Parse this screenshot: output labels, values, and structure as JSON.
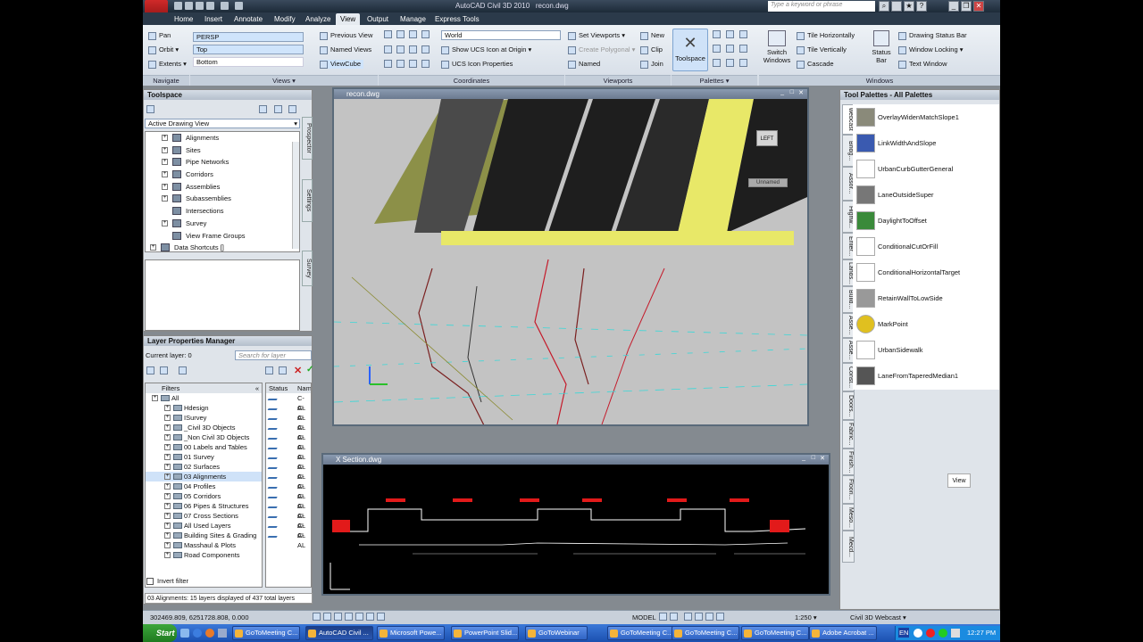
{
  "title": {
    "app": "AutoCAD Civil 3D 2010",
    "file": "recon.dwg"
  },
  "search": {
    "placeholder": "Type a keyword or phrase"
  },
  "tabs": [
    "Home",
    "Insert",
    "Annotate",
    "Modify",
    "Analyze",
    "View",
    "Output",
    "Manage",
    "Express Tools"
  ],
  "active_tab": "View",
  "ribbon": {
    "navigate": {
      "pan": "Pan",
      "orbit": "Orbit",
      "extents": "Extents",
      "title": "Navigate"
    },
    "views": {
      "persp": "PERSP",
      "top": "Top",
      "bottom": "Bottom",
      "previous": "Previous View",
      "named": "Named Views",
      "viewcube": "ViewCube",
      "title": "Views"
    },
    "coordinates": {
      "world": "World",
      "show_ucs": "Show UCS Icon at Origin",
      "ucs_props": "UCS Icon Properties",
      "title": "Coordinates"
    },
    "viewports": {
      "set": "Set Viewports",
      "create_poly": "Create Polygonal",
      "named": "Named",
      "new": "New",
      "clip": "Clip",
      "join": "Join",
      "title": "Viewports"
    },
    "palettes": {
      "toolspace": "Toolspace",
      "title": "Palettes"
    },
    "windows": {
      "switch": "Switch Windows",
      "tile_h": "Tile Horizontally",
      "tile_v": "Tile Vertically",
      "cascade": "Cascade",
      "status_bar": "Status Bar",
      "drawing_status": "Drawing Status Bar",
      "window_locking": "Window Locking",
      "text_window": "Text Window",
      "title": "Windows"
    }
  },
  "toolspace": {
    "title": "Toolspace",
    "view_selector": "Active Drawing View",
    "items": [
      "Alignments",
      "Sites",
      "Pipe Networks",
      "Corridors",
      "Assemblies",
      "Subassemblies",
      "Intersections",
      "Survey",
      "View Frame Groups",
      "Data Shortcuts []"
    ],
    "vtabs": [
      "Prospector",
      "Settings",
      "Survey"
    ]
  },
  "layers": {
    "title": "Layer Properties Manager",
    "current": "Current layer: 0",
    "search_placeholder": "Search for layer",
    "filters_header": "Filters",
    "status_header": "Status",
    "name_header": "Nam",
    "filters": [
      "All",
      "Hdesign",
      "ISurvey",
      "_Civil 3D Objects",
      "_Non Civil 3D Objects",
      "00 Labels and Tables",
      "01 Survey",
      "02 Surfaces",
      "03 Alignments",
      "04 Profiles",
      "05 Corridors",
      "06 Pipes & Structures",
      "07 Cross Sections",
      "All Used Layers",
      "Building Sites & Grading",
      "Masshaul & Plots",
      "Road Components"
    ],
    "name_cells": [
      "C-AL",
      "C-AL",
      "C-AL",
      "C-AL",
      "C-AL",
      "C-AL",
      "C-AL",
      "C-AL",
      "C-AL",
      "C-AL",
      "C-AL",
      "C-AL",
      "C-AL",
      "C-AL",
      "C-AL"
    ],
    "invert": "Invert filter",
    "footer": "03 Alignments: 15 layers displayed of 437 total layers"
  },
  "drawing1": {
    "title": "recon.dwg",
    "viewcube_face": "LEFT",
    "viewcube_label": "Unnamed"
  },
  "drawing2": {
    "title": "X Section.dwg"
  },
  "palettes": {
    "title": "Tool Palettes - All Palettes",
    "items": [
      "OverlayWidenMatchSlope1",
      "LinkWidthAndSlope",
      "UrbanCurbGutterGeneral",
      "LaneOutsideSuper",
      "DaylightToOffset",
      "ConditionalCutOrFill",
      "ConditionalHorizontalTarget",
      "RetainWallToLowSide",
      "MarkPoint",
      "UrbanSidewalk",
      "LaneFromTaperedMedian1"
    ],
    "tabs": [
      "webcast",
      "Bridg...",
      "Assor...",
      "Highw...",
      "Enter...",
      "Lands...",
      "Build...",
      "Asse...",
      "Asse...",
      "Const...",
      "Doors...",
      "Fabric...",
      "Finish...",
      "Floori...",
      "Meso...",
      "Mecd..."
    ],
    "view_btn": "View"
  },
  "status": {
    "coords": "302469.809, 6251728.808, 0.000",
    "model": "MODEL",
    "scale": "1:250",
    "workspace": "Civil 3D Webcast"
  },
  "taskbar": {
    "start": "Start",
    "items": [
      "GoToMeeting C...",
      "AutoCAD Civil ...",
      "Microsoft Powe...",
      "PowerPoint Slid...",
      "GoToWebinar",
      "GoToMeeting C...",
      "GoToMeeting C...",
      "GoToMeeting C...",
      "Adobe Acrobat ..."
    ],
    "lang": "EN",
    "clock": "12:27 PM"
  },
  "colors": {
    "accent": "#3a5bb0",
    "ribbon_bg": "#dfe5ec",
    "taskbar": "#2457c5"
  }
}
